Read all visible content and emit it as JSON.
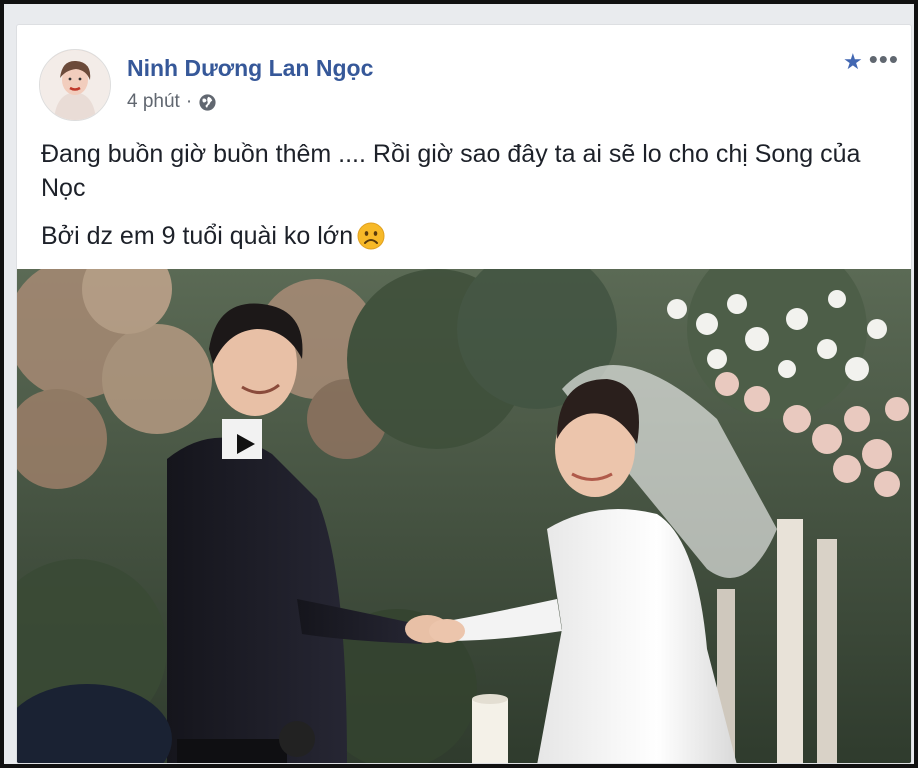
{
  "post": {
    "author": "Ninh Dương Lan Ngọc",
    "time": "4 phút",
    "separator": "·",
    "privacy_icon": "globe-icon",
    "lines": [
      "Đang buồn giờ buồn thêm .... Rồi giờ sao đây ta ai sẽ lo cho chị Song của Nọc",
      "Bởi dz em 9 tuổi quài ko lớn"
    ],
    "emoji": "frowning-face-icon",
    "actions": {
      "star_icon": "star-icon",
      "more_icon": "more-options-icon",
      "more_label": "•••"
    }
  },
  "colors": {
    "author_link": "#365899",
    "meta_text": "#616770",
    "accent_star": "#4267b2",
    "body_text": "#1d2129"
  }
}
